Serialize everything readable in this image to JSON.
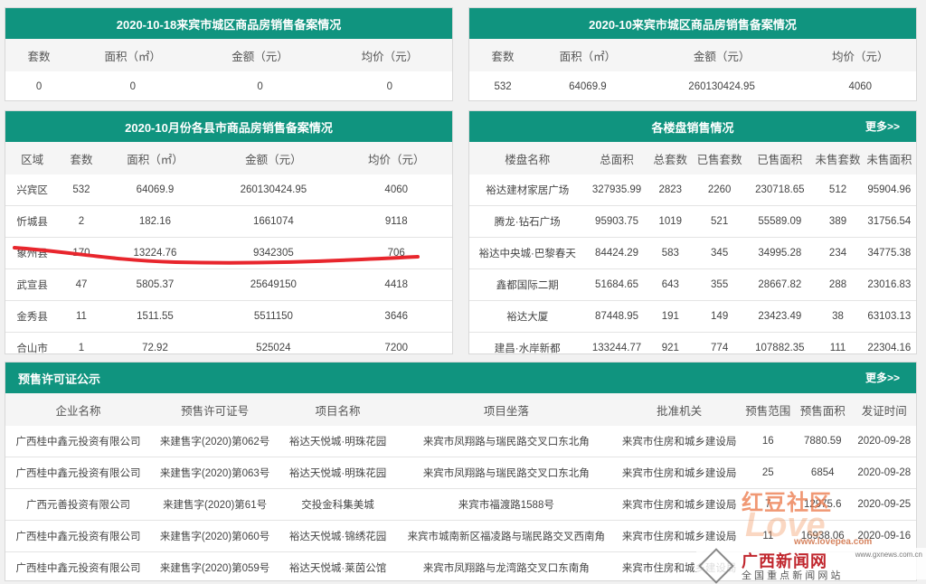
{
  "panel_a": {
    "title": "2020-10-18来宾市城区商品房销售备案情况",
    "headers": [
      "套数",
      "面积（㎡）",
      "金额（元）",
      "均价（元）"
    ],
    "rows": [
      [
        "0",
        "0",
        "0",
        "0"
      ]
    ]
  },
  "panel_b": {
    "title": "2020-10来宾市城区商品房销售备案情况",
    "headers": [
      "套数",
      "面积（㎡）",
      "金额（元）",
      "均价（元）"
    ],
    "rows": [
      [
        "532",
        "64069.9",
        "260130424.95",
        "4060"
      ]
    ]
  },
  "panel_c": {
    "title": "2020-10月份各县市商品房销售备案情况",
    "headers": [
      "区域",
      "套数",
      "面积（㎡）",
      "金额（元）",
      "均价（元）"
    ],
    "rows": [
      [
        "兴宾区",
        "532",
        "64069.9",
        "260130424.95",
        "4060"
      ],
      [
        "忻城县",
        "2",
        "182.16",
        "1661074",
        "9118"
      ],
      [
        "象州县",
        "170",
        "13224.76",
        "9342305",
        "706"
      ],
      [
        "武宣县",
        "47",
        "5805.37",
        "25649150",
        "4418"
      ],
      [
        "金秀县",
        "11",
        "1511.55",
        "5511150",
        "3646"
      ],
      [
        "合山市",
        "1",
        "72.92",
        "525024",
        "7200"
      ]
    ]
  },
  "panel_d": {
    "title": "各楼盘销售情况",
    "more": "更多>>",
    "headers": [
      "楼盘名称",
      "总面积",
      "总套数",
      "已售套数",
      "已售面积",
      "未售套数",
      "未售面积"
    ],
    "rows": [
      [
        "裕达建材家居广场",
        "327935.99",
        "2823",
        "2260",
        "230718.65",
        "512",
        "95904.96"
      ],
      [
        "腾龙·钻石广场",
        "95903.75",
        "1019",
        "521",
        "55589.09",
        "389",
        "31756.54"
      ],
      [
        "裕达中央城·巴黎春天",
        "84424.29",
        "583",
        "345",
        "34995.28",
        "234",
        "34775.38"
      ],
      [
        "鑫都国际二期",
        "51684.65",
        "643",
        "355",
        "28667.82",
        "288",
        "23016.83"
      ],
      [
        "裕达大厦",
        "87448.95",
        "191",
        "149",
        "23423.49",
        "38",
        "63103.13"
      ],
      [
        "建昌·水岸新都",
        "133244.77",
        "921",
        "774",
        "107882.35",
        "111",
        "22304.16"
      ]
    ]
  },
  "panel_e": {
    "title": "预售许可证公示",
    "more": "更多>>",
    "headers": [
      "企业名称",
      "预售许可证号",
      "项目名称",
      "项目坐落",
      "批准机关",
      "预售范围",
      "预售面积",
      "发证时间"
    ],
    "rows": [
      [
        "广西桂中鑫元投资有限公司",
        "来建售字(2020)第062号",
        "裕达天悦城·明珠花园",
        "来宾市凤翔路与瑞民路交叉口东北角",
        "来宾市住房和城乡建设局",
        "16",
        "7880.59",
        "2020-09-28"
      ],
      [
        "广西桂中鑫元投资有限公司",
        "来建售字(2020)第063号",
        "裕达天悦城·明珠花园",
        "来宾市凤翔路与瑞民路交叉口东北角",
        "来宾市住房和城乡建设局",
        "25",
        "6854",
        "2020-09-28"
      ],
      [
        "广西元善投资有限公司",
        "来建售字(2020)第61号",
        "交投金科集美城",
        "来宾市福渡路1588号",
        "来宾市住房和城乡建设局",
        "7",
        "12975.6",
        "2020-09-25"
      ],
      [
        "广西桂中鑫元投资有限公司",
        "来建售字(2020)第060号",
        "裕达天悦城·锦绣花园",
        "来宾市城南新区福凌路与瑞民路交叉西南角",
        "来宾市住房和城乡建设局",
        "11",
        "16938.06",
        "2020-09-16"
      ],
      [
        "广西桂中鑫元投资有限公司",
        "来建售字(2020)第059号",
        "裕达天悦城·莱茵公馆",
        "来宾市凤翔路与龙湾路交叉口东南角",
        "来宾市住房和城乡建设局",
        "",
        "",
        ""
      ]
    ]
  },
  "watermark": {
    "brand": "红豆社区",
    "logo": "Love",
    "url": "www.lovepea.com",
    "site": "广西新闻网",
    "slogan": "全 国 重 点 新 闻 网 站",
    "small_url": "www.gxnews.com.cn"
  }
}
